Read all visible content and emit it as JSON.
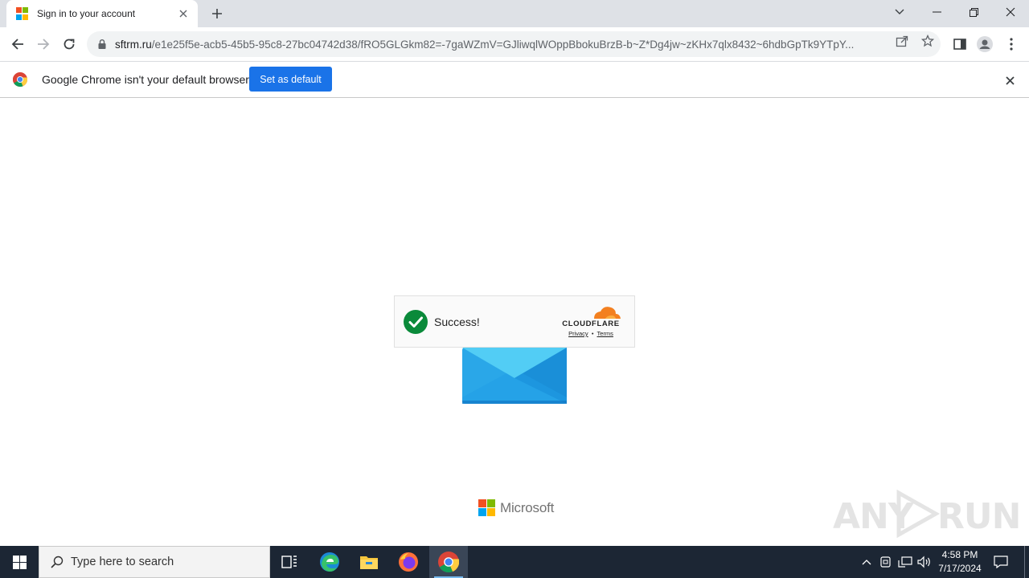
{
  "browser": {
    "tab": {
      "title": "Sign in to your account",
      "favicon_colors": [
        "#f25022",
        "#7fba00",
        "#00a4ef",
        "#ffb900"
      ]
    },
    "address": {
      "host": "sftrm.ru",
      "path": "/e1e25f5e-acb5-45b5-95c8-27bc04742d38/fRO5GLGkm82=-7gaWZmV=GJliwqlWOppBbokuBrzB-b~Z*Dg4jw~zKHx7qlx8432~6hdbGpTk9YTpY..."
    },
    "icons": {
      "back": "arrow-left-icon",
      "forward": "arrow-right-icon",
      "reload": "reload-icon",
      "lock": "lock-icon",
      "share": "share-icon",
      "bookmark": "star-icon",
      "side_panel": "side-panel-icon",
      "profile": "profile-icon",
      "menu": "kebab-menu-icon"
    }
  },
  "infobar": {
    "message": "Google Chrome isn't your default browser",
    "button_label": "Set as default"
  },
  "page": {
    "captcha": {
      "status": "Success!",
      "brand": "CLOUDFLARE",
      "privacy_link": "Privacy",
      "separator": "•",
      "terms_link": "Terms",
      "check_color": "#0a8a3a",
      "cloud_color": "#f38020"
    },
    "footer_brand": "Microsoft",
    "watermark_text_left": "ANY",
    "watermark_text_right": "RUN"
  },
  "taskbar": {
    "search_placeholder": "Type here to search",
    "apps": [
      "task-view",
      "edge",
      "file-explorer",
      "firefox",
      "chrome"
    ],
    "active_app": "chrome",
    "time": "4:58 PM",
    "date": "7/17/2024"
  },
  "colors": {
    "accent_blue": "#1a73e8",
    "taskbar_bg": "#1c2634",
    "envelope_light": "#3fc1f0",
    "envelope_dark": "#1a8fd8"
  }
}
